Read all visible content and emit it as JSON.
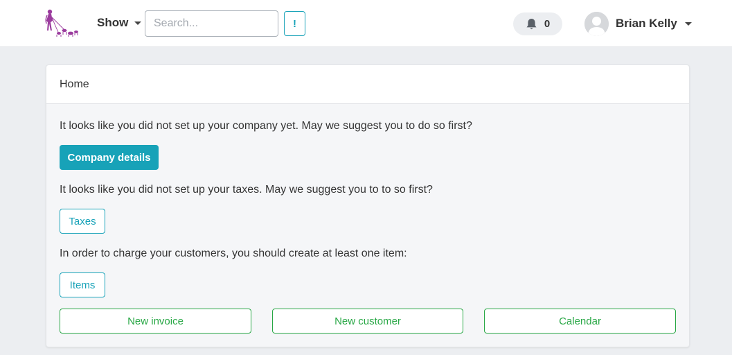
{
  "topbar": {
    "show_label": "Show",
    "search": {
      "placeholder": "Search...",
      "value": ""
    },
    "bang_label": "!",
    "notifications_count": "0",
    "user_name": "Brian Kelly"
  },
  "card": {
    "header": "Home",
    "company_message": "It looks like you did not set up your company yet. May we suggest you to do so first?",
    "company_button": "Company details",
    "taxes_message": "It looks like you did not set up your taxes. May we suggest you to to so first?",
    "taxes_button": "Taxes",
    "items_message": "In order to charge your customers, you should create at least one item:",
    "items_button": "Items",
    "actions": {
      "new_invoice": "New invoice",
      "new_customer": "New customer",
      "calendar": "Calendar"
    }
  },
  "colors": {
    "info": "#17a2b8",
    "success": "#28a745",
    "logo": "#9b3c9e",
    "background": "#eceef1"
  },
  "icons": [
    "logo-icon",
    "caret-down-icon",
    "bell-icon",
    "avatar-icon"
  ]
}
